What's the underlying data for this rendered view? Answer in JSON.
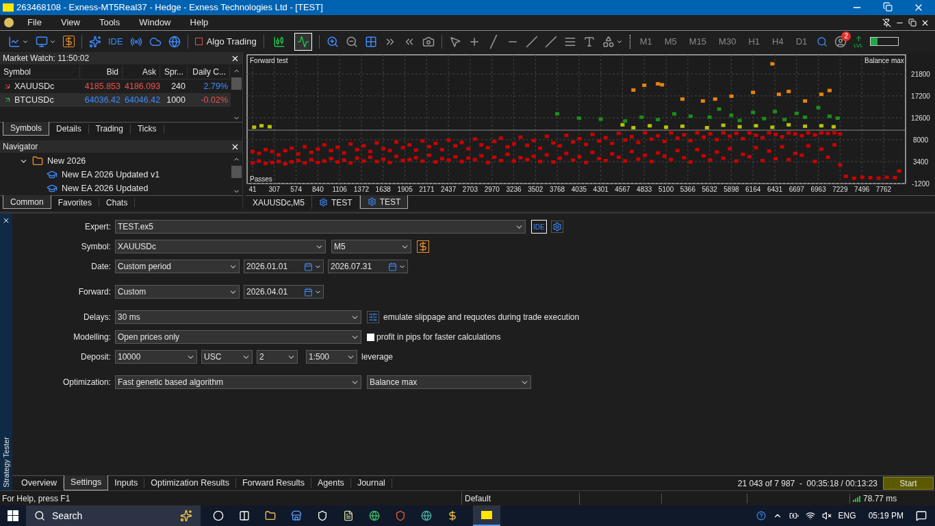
{
  "window": {
    "title": "263468108 - Exness-MT5Real37 - Hedge - Exness Technologies Ltd - [TEST]"
  },
  "menu": [
    "File",
    "View",
    "Tools",
    "Window",
    "Help"
  ],
  "toolbar": {
    "ide": "IDE",
    "algo_trading": {
      "label": "Algo Trading",
      "on": false
    },
    "chart_types": [
      {
        "kind": "candles",
        "selected": false
      },
      {
        "kind": "line",
        "selected": true
      }
    ],
    "timeframes": [
      "M1",
      "M5",
      "M15",
      "M30",
      "H1",
      "H4",
      "D1"
    ],
    "notifications": "2",
    "lvl": "LVL"
  },
  "market_watch": {
    "title": "Market Watch: 11:50:02",
    "columns": [
      "Symbol",
      "Bid",
      "Ask",
      "Spr...",
      "Daily C..."
    ],
    "rows": [
      {
        "symbol": "XAUUSDc",
        "rising": false,
        "bid": "4185.853",
        "ask": "4186.093",
        "spread": "240",
        "change": "2.79%",
        "change_positive": true,
        "selected": false
      },
      {
        "symbol": "BTCUSDc",
        "rising": true,
        "bid": "64036.42",
        "ask": "64046.42",
        "spread": "1000",
        "change": "-0.02%",
        "change_positive": false,
        "selected": true
      }
    ],
    "tabs": [
      {
        "label": "Symbols",
        "selected": true
      },
      {
        "label": "Details",
        "selected": false
      },
      {
        "label": "Trading",
        "selected": false
      },
      {
        "label": "Ticks",
        "selected": false
      }
    ]
  },
  "navigator": {
    "title": "Navigator",
    "tree": [
      {
        "label": "New 2026",
        "expanded": true,
        "children": [
          {
            "label": "New EA 2026 Updated v1"
          },
          {
            "label": "New EA 2026 Updated"
          }
        ]
      }
    ],
    "tabs": [
      {
        "label": "Common",
        "selected": true
      },
      {
        "label": "Favorites",
        "selected": false
      },
      {
        "label": "Chats",
        "selected": false
      }
    ]
  },
  "chart": {
    "title_left": "Forward test",
    "title_right": "Balance max",
    "corner_label": "Passes",
    "chart_data": {
      "type": "scatter",
      "xlim": [
        41,
        8030
      ],
      "ylim": [
        -1200,
        25825
      ],
      "xticks": [
        41,
        307,
        574,
        840,
        1106,
        1372,
        1638,
        1905,
        2171,
        2437,
        2703,
        2970,
        3236,
        3502,
        3768,
        4035,
        4301,
        4567,
        4833,
        5100,
        5366,
        5632,
        5898,
        6164,
        6431,
        6697,
        6963,
        7229,
        7496,
        7762
      ],
      "yticks": [
        -1200,
        3400,
        8000,
        12600,
        17200,
        21800
      ],
      "grid": true,
      "ref_lines": [
        {
          "axis": "y",
          "value": 10000
        }
      ],
      "series": [
        {
          "color": "#cc0000",
          "x": [
            41,
            120,
            200,
            280,
            360,
            440,
            520,
            600,
            680,
            760,
            840,
            920,
            1000,
            1080,
            1160,
            1240,
            1320,
            1400,
            1480,
            1560,
            1640,
            1720,
            1800,
            1880,
            1960,
            2040,
            2120,
            2200,
            2280,
            2360,
            2440,
            2520,
            2600,
            2680,
            2760,
            2840,
            2920,
            3000,
            3080,
            3160,
            3240,
            3320,
            3400,
            3480,
            3560,
            3640,
            3720,
            3800,
            3880,
            3960,
            4040,
            4120,
            4200,
            4280,
            4360,
            4440,
            4520,
            4600,
            4680,
            4760,
            4840,
            4920,
            5000,
            5080,
            5160,
            5240,
            5320,
            5400,
            5480,
            5560,
            5640,
            5720,
            5800,
            5880,
            5960,
            6040,
            6120,
            6200,
            6280,
            6360,
            6440,
            6520,
            6600,
            6680,
            6760,
            6840,
            6920,
            7000,
            7080,
            7160,
            7229,
            41,
            120,
            200,
            280,
            360,
            440,
            520,
            600,
            680,
            760,
            840,
            920,
            1000,
            1080,
            1160,
            1240,
            1320,
            1400,
            1480,
            1560,
            1640,
            1720,
            1800,
            1880,
            1960,
            2040,
            2120,
            2200,
            2280,
            2360,
            2440,
            2520,
            2600,
            2680,
            2760,
            2840,
            2920,
            3000,
            3080,
            3160,
            3240,
            3320,
            3400,
            3480,
            3560,
            3640,
            3720,
            3800,
            3880,
            3960,
            4040,
            4120,
            4200,
            4280,
            4360,
            4440,
            4520,
            4600,
            4680,
            4760,
            4840,
            4920,
            5000,
            5080,
            5160,
            5240,
            5320,
            5400,
            5480,
            5560,
            5640,
            5720,
            5800,
            5880,
            5960,
            6040,
            6120,
            6200,
            6280,
            6360,
            6440,
            6520,
            6600,
            6680,
            6760,
            6840,
            6920,
            7000,
            7080,
            7160,
            7229,
            7300,
            7400,
            7500,
            7600,
            7700,
            7800,
            7900,
            7950
          ],
          "values": [
            3200,
            3600,
            3100,
            3300,
            3500,
            3000,
            3400,
            3700,
            3200,
            3900,
            3300,
            3600,
            4100,
            3400,
            3800,
            3200,
            4200,
            3600,
            4400,
            3500,
            4000,
            3300,
            4600,
            3700,
            3900,
            4300,
            3600,
            4800,
            3400,
            4100,
            3800,
            4500,
            3500,
            4200,
            3900,
            4700,
            3300,
            4400,
            3700,
            5000,
            3600,
            4300,
            3900,
            4600,
            3500,
            4900,
            3400,
            4200,
            5200,
            3800,
            4500,
            3300,
            5400,
            4100,
            3700,
            5100,
            4400,
            3600,
            5600,
            4000,
            4800,
            3500,
            5300,
            4600,
            3900,
            5800,
            4300,
            3400,
            6000,
            4700,
            3800,
            5500,
            4200,
            6200,
            3600,
            5000,
            4500,
            6400,
            3700,
            5700,
            4100,
            6600,
            3900,
            5200,
            4800,
            6800,
            3500,
            6100,
            4400,
            7000,
            2800,
            5600,
            5200,
            6000,
            5600,
            4900,
            5800,
            6300,
            5100,
            6600,
            5400,
            6100,
            7000,
            5800,
            6500,
            5300,
            7200,
            6000,
            6800,
            5600,
            7400,
            6200,
            5800,
            7600,
            6400,
            7000,
            5900,
            7800,
            6600,
            7300,
            6000,
            8000,
            6800,
            7500,
            6200,
            8200,
            7000,
            6400,
            7700,
            8400,
            6600,
            7200,
            8600,
            6900,
            7900,
            6300,
            8800,
            7400,
            6800,
            9000,
            7600,
            8300,
            7100,
            9200,
            7800,
            8500,
            7300,
            9400,
            8000,
            8700,
            7500,
            9500,
            8200,
            8900,
            7700,
            9500,
            8400,
            9100,
            7900,
            9500,
            8600,
            9300,
            8100,
            9500,
            8800,
            9400,
            8300,
            9500,
            9000,
            8500,
            9500,
            9200,
            8700,
            9500,
            9300,
            8900,
            9500,
            9100,
            9500,
            9400,
            9500,
            9300,
            400,
            0,
            200,
            100,
            0,
            200,
            100,
            1500
          ]
        },
        {
          "color": "#1a8f1a",
          "x": [
            3768,
            4035,
            4301,
            4600,
            4800,
            5000,
            5200,
            5400,
            5632,
            5750,
            5898,
            6000,
            6164,
            6300,
            6431,
            6550,
            6697,
            6800,
            6963,
            7100,
            7200
          ],
          "values": [
            13500,
            12600,
            12400,
            12000,
            12800,
            12300,
            13500,
            13000,
            12800,
            14500,
            13200,
            12100,
            13800,
            12500,
            14000,
            12300,
            13600,
            12800,
            14800,
            13000,
            12600
          ]
        },
        {
          "color": "#b5c400",
          "x": [
            60,
            150,
            250,
            4567,
            4700,
            4900,
            5100,
            5300,
            5600,
            5800,
            6000,
            6200,
            6400,
            6600,
            6800,
            7000,
            7150
          ],
          "values": [
            10700,
            11000,
            10800,
            11200,
            10600,
            11000,
            10700,
            10900,
            10600,
            11100,
            10800,
            11000,
            10700,
            11200,
            10900,
            11000,
            10800
          ]
        },
        {
          "color": "#e8820c",
          "x": [
            4700,
            4833,
            5000,
            5050,
            5300,
            5550,
            5700,
            5900,
            6164,
            6400,
            6480,
            6600,
            6800,
            7000,
            7100
          ],
          "values": [
            18500,
            19500,
            19800,
            19600,
            16600,
            16200,
            16600,
            17200,
            18000,
            24000,
            17600,
            18200,
            16200,
            17600,
            18400
          ]
        }
      ]
    }
  },
  "chart_tabs": [
    {
      "label": "XAUUSDc,M5",
      "kind": "chart",
      "selected": false
    },
    {
      "label": "TEST",
      "kind": "tester",
      "selected": false
    },
    {
      "label": "TEST",
      "kind": "tester",
      "selected": true
    }
  ],
  "tester": {
    "label": "Strategy Tester",
    "labels": {
      "expert": "Expert:",
      "symbol": "Symbol:",
      "date": "Date:",
      "forward": "Forward:",
      "delays": "Delays:",
      "modelling": "Modelling:",
      "deposit": "Deposit:",
      "optimization": "Optimization:"
    },
    "expert": "TEST.ex5",
    "ide": "IDE",
    "symbol": "XAUUSDc",
    "timeframe": "M5",
    "date": "Custom period",
    "date_from": "2026.01.01",
    "date_to": "2026.07.31",
    "forward": "Custom",
    "forward_date": "2026.04.01",
    "delays": "30 ms",
    "delays_note": "emulate slippage and requotes during trade execution",
    "modelling": "Open prices only",
    "profit_pips": {
      "label": "profit in pips for faster calculations",
      "checked": false
    },
    "deposit": "10000",
    "currency": "USC",
    "digits": "2",
    "leverage": "1:500",
    "leverage_label": "leverage",
    "optimization": "Fast genetic based algorithm",
    "criterion": "Balance max",
    "tabs": [
      {
        "label": "Overview",
        "selected": false
      },
      {
        "label": "Settings",
        "selected": true
      },
      {
        "label": "Inputs",
        "selected": false
      },
      {
        "label": "Optimization Results",
        "selected": false
      },
      {
        "label": "Forward Results",
        "selected": false
      },
      {
        "label": "Agents",
        "selected": false
      },
      {
        "label": "Journal",
        "selected": false
      }
    ],
    "progress": "21 043 of 7 987  -  00:35:18 / 00:13:23",
    "start": "Start"
  },
  "status_bar": {
    "help": "For Help, press F1",
    "profile": "Default",
    "ping": "78.77 ms"
  },
  "taskbar": {
    "search": "Search",
    "language": "ENG",
    "time": "05:19 PM"
  }
}
